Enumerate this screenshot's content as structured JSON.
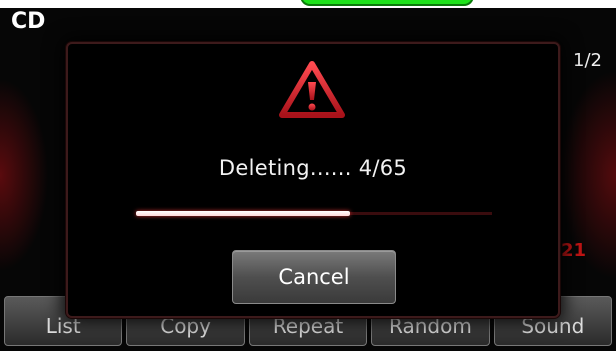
{
  "header": {
    "source": "CD",
    "track_counter": "1/2",
    "side_number": "21"
  },
  "bottom_bar": {
    "buttons": [
      {
        "label": "List"
      },
      {
        "label": "Copy"
      },
      {
        "label": "Repeat"
      },
      {
        "label": "Random"
      },
      {
        "label": "Sound"
      }
    ]
  },
  "dialog": {
    "icon": "warning-icon",
    "message": "Deleting...... 4/65",
    "progress": 0.6,
    "cancel_label": "Cancel"
  },
  "colors": {
    "accent_red": "#d01a22",
    "dialog_border": "#3d1a1b",
    "button_gray": "#5a5a5a"
  }
}
